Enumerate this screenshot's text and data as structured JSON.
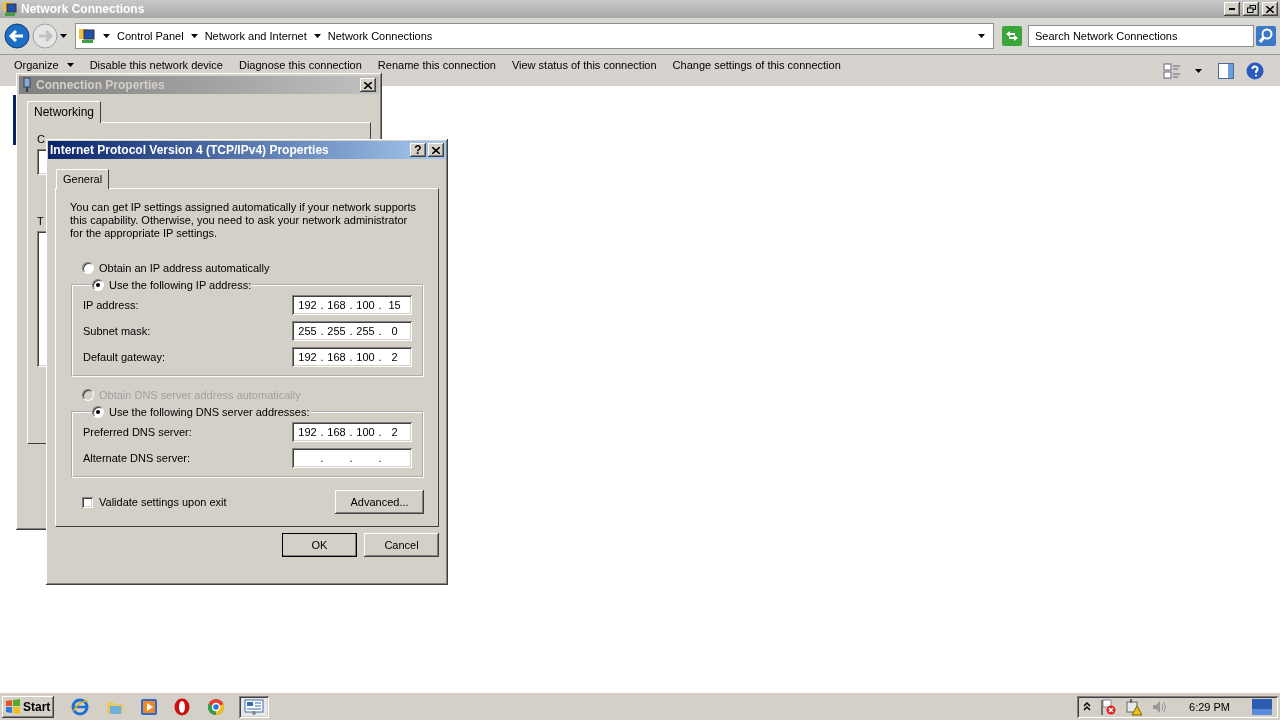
{
  "explorer": {
    "title": "Network Connections",
    "breadcrumb": [
      "Control Panel",
      "Network and Internet",
      "Network Connections"
    ],
    "search": {
      "placeholder": "Search Network Connections"
    },
    "commands": [
      {
        "label": "Organize",
        "kind": "menu"
      },
      {
        "label": "Disable this network device",
        "kind": "action"
      },
      {
        "label": "Diagnose this connection",
        "kind": "action"
      },
      {
        "label": "Rename this connection",
        "kind": "action"
      },
      {
        "label": "View status of this connection",
        "kind": "action"
      },
      {
        "label": "Change settings of this connection",
        "kind": "action"
      }
    ]
  },
  "connection_properties": {
    "title": "Connection Properties",
    "tabs": [
      {
        "label": "Networking",
        "selected": true
      }
    ],
    "labels": [
      "C",
      "T"
    ]
  },
  "ipv4_dialog": {
    "title": "Internet Protocol Version 4 (TCP/IPv4) Properties",
    "help": "?",
    "tabs": [
      {
        "label": "General",
        "selected": true
      }
    ],
    "description": "You can get IP settings assigned automatically if your network supports this capability. Otherwise, you need to ask your network administrator for the appropriate IP settings.",
    "separator": ".",
    "ip_options": [
      {
        "label": "Obtain an IP address automatically",
        "selected": false,
        "disabled": false
      },
      {
        "label": "Use the following IP address:",
        "selected": true,
        "disabled": false
      }
    ],
    "ip_fields": [
      {
        "label": "IP address:",
        "octets": [
          "192",
          "168",
          "100",
          "15"
        ]
      },
      {
        "label": "Subnet mask:",
        "octets": [
          "255",
          "255",
          "255",
          "0"
        ]
      },
      {
        "label": "Default gateway:",
        "octets": [
          "192",
          "168",
          "100",
          "2"
        ]
      }
    ],
    "dns_options": [
      {
        "label": "Obtain DNS server address automatically",
        "selected": false,
        "disabled": true
      },
      {
        "label": "Use the following DNS server addresses:",
        "selected": true,
        "disabled": false
      }
    ],
    "dns_fields": [
      {
        "label": "Preferred DNS server:",
        "octets": [
          "192",
          "168",
          "100",
          "2"
        ]
      },
      {
        "label": "Alternate DNS server:"
      }
    ],
    "validate": {
      "label": "Validate settings upon exit",
      "checked": false
    },
    "advanced": "Advanced...",
    "ok": "OK",
    "cancel": "Cancel"
  },
  "taskbar": {
    "start": "Start",
    "clock": "6:29 PM"
  }
}
